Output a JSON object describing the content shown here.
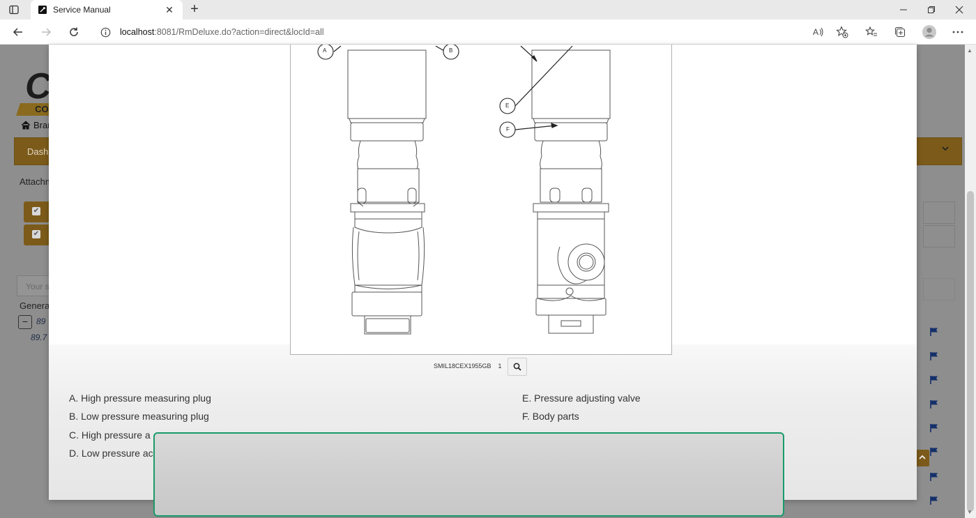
{
  "browser": {
    "tab_title": "Service Manual",
    "url_host": "localhost",
    "url_path": ":8081/RmDeluxe.do?action=direct&locId=all"
  },
  "app": {
    "logo_bar_text": "CO",
    "logo_letter": "C",
    "breadcrumb": "Bran",
    "tab_label": "Dash",
    "attach_label": "Attachm",
    "search_placeholder": "Your s",
    "general_label": "Genera",
    "tree_value_1": "89",
    "tree_value_2": "89.7"
  },
  "diagram": {
    "callouts": [
      "A",
      "B",
      "E",
      "F"
    ],
    "caption_code": "SMIL18CEX1955GB",
    "caption_page": "1"
  },
  "legend": {
    "items_left": [
      "A. High pressure measuring plug",
      "B. Low pressure measuring plug",
      "C. High pressure a",
      "D. Low pressure ac"
    ],
    "items_right": [
      "E. Pressure adjusting valve",
      "F. Body parts"
    ]
  },
  "colors": {
    "accent_orange": "#7c5b1a",
    "overlay_border": "#1a9a6a",
    "flag_blue": "#15306a"
  }
}
